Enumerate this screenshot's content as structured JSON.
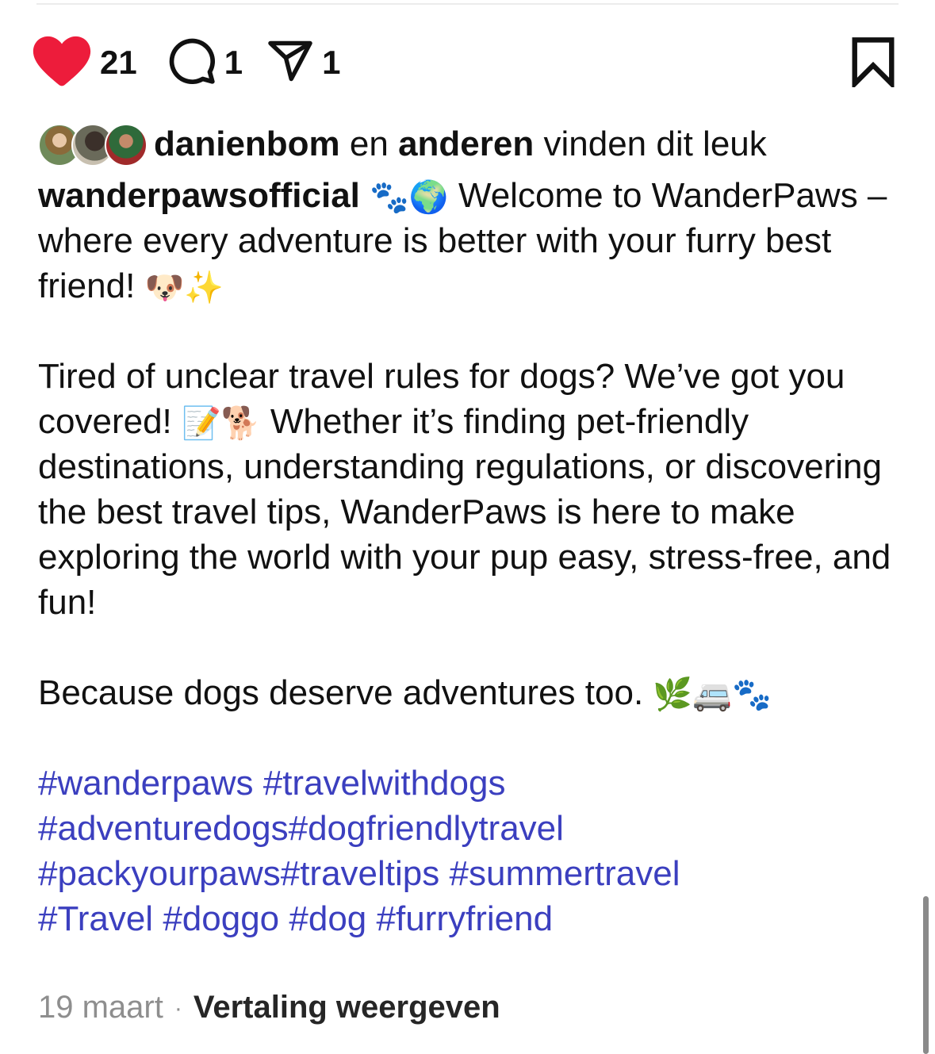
{
  "actions": {
    "likes_count": "21",
    "comments_count": "1",
    "shares_count": "1",
    "like_color": "#ed1c3b"
  },
  "liked_by": {
    "user": "danienbom",
    "connector": " en ",
    "others": "anderen",
    "suffix": " vinden dit leuk"
  },
  "caption": {
    "username": "wanderpawsofficial",
    "emoji_1": "🐾🌍",
    "line_1": " Welcome to WanderPaws – where every adventure is better with your furry best friend! ",
    "emoji_2": "🐶✨",
    "para_2a": "Tired of unclear travel rules for dogs? We’ve got you covered! ",
    "emoji_3": "📝🐕",
    "para_2b": " Whether it’s finding pet-friendly destinations, understanding regulations, or discovering the best travel tips, WanderPaws is here to make exploring the world with your pup easy, stress-free, and fun!",
    "para_3": "Because dogs deserve adventures too. ",
    "emoji_4": "🌿🚐🐾"
  },
  "hashtags": [
    "#wanderpaws",
    "#travelwithdogs",
    "#adventuredogs",
    "#dogfriendlytravel",
    "#packyourpaws",
    "#traveltips",
    "#summertravel",
    "#Travel",
    "#doggo",
    "#dog",
    "#furryfriend"
  ],
  "meta": {
    "date": "19 maart",
    "separator": "·",
    "translate_label": "Vertaling weergeven"
  },
  "colors": {
    "hashtag": "#3b3fbf",
    "muted": "#8e8e8e"
  }
}
